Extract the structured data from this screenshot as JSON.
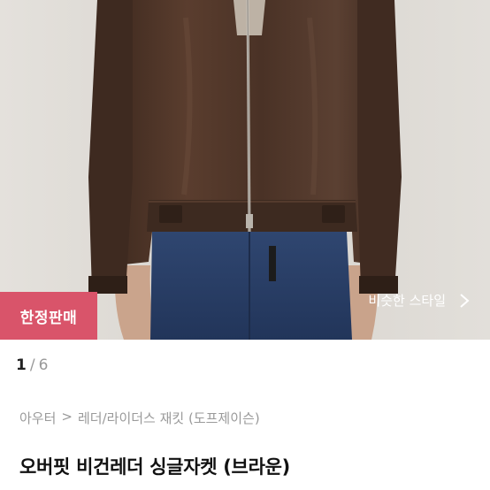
{
  "hero": {
    "image_icon": "jacket-photo",
    "limited_badge": "한정판매",
    "similar_style_label": "비슷한 스타일",
    "similar_style_icon": "chevron-right-icon"
  },
  "pager": {
    "current": "1",
    "separator": "/",
    "total": "6"
  },
  "breadcrumb": {
    "category": "아우터",
    "separator": ">",
    "subcategory": "레더/라이더스 재킷 (도프제이슨)"
  },
  "product": {
    "title": "오버핏 비건레더 싱글자켓 (브라운)"
  },
  "colors": {
    "badge": "#d9546a",
    "jacket": "#4a3226",
    "jeans": "#2b3f63"
  }
}
